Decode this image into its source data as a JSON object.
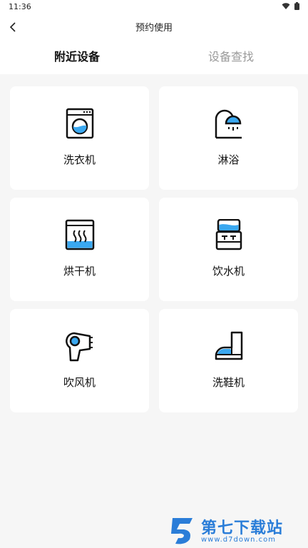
{
  "status_bar": {
    "time": "11:36"
  },
  "header": {
    "title": "预约使用",
    "tabs": [
      {
        "label": "附近设备",
        "active": true
      },
      {
        "label": "设备查找",
        "active": false
      }
    ]
  },
  "devices": [
    {
      "label": "洗衣机",
      "icon": "washing-machine-icon"
    },
    {
      "label": "淋浴",
      "icon": "shower-icon"
    },
    {
      "label": "烘干机",
      "icon": "dryer-icon"
    },
    {
      "label": "饮水机",
      "icon": "water-dispenser-icon"
    },
    {
      "label": "吹风机",
      "icon": "hair-dryer-icon"
    },
    {
      "label": "洗鞋机",
      "icon": "shoe-washer-icon"
    }
  ],
  "watermark": {
    "title": "第七下载站",
    "url": "www.d7down.com"
  },
  "colors": {
    "accent_blue": "#3aa8f0",
    "watermark_blue": "#2a7dd8",
    "background": "#f6f6f6"
  }
}
